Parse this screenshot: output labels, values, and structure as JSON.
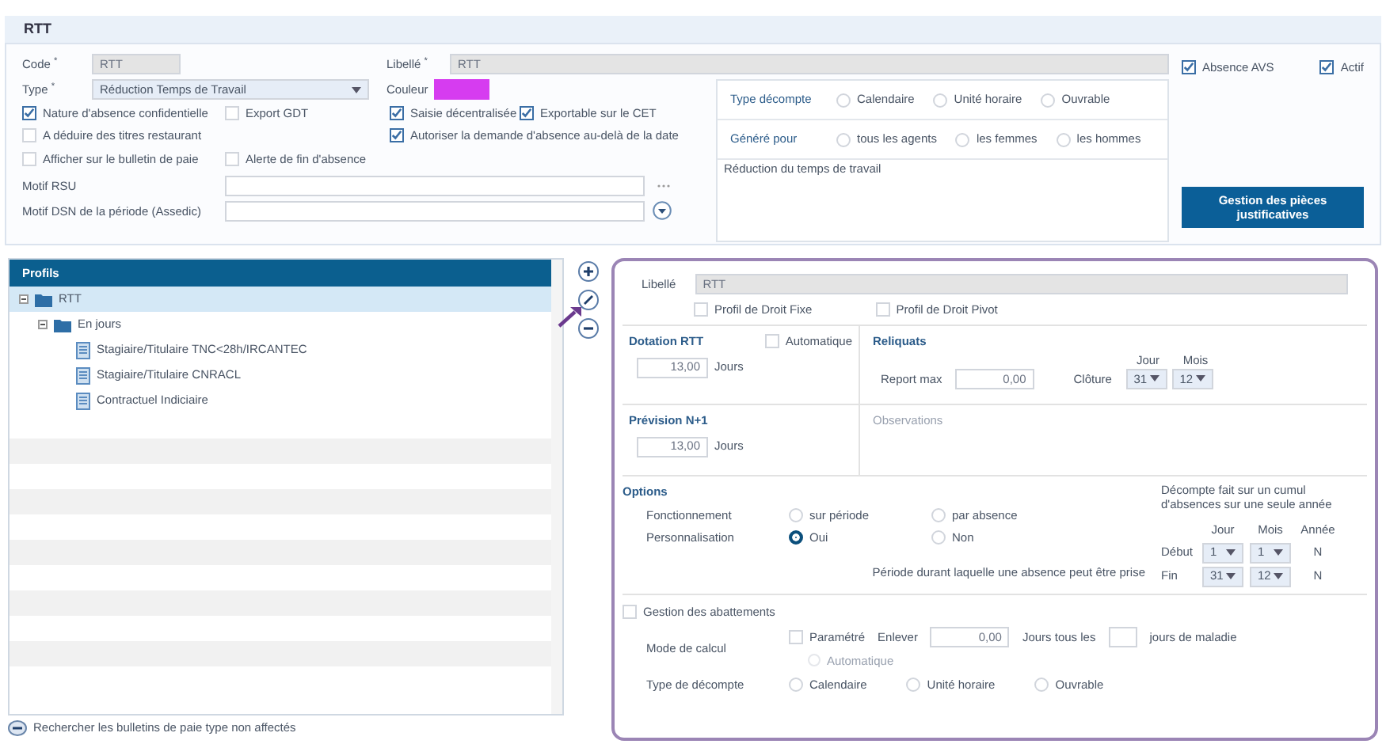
{
  "title": "RTT",
  "general": {
    "code": {
      "label": "Code $^{*}$",
      "value": "RTT"
    },
    "libelle": {
      "label": "Libellé $^{*}$",
      "value": "RTT"
    },
    "type": {
      "label": "Type $^{*}$",
      "value": "Réduction Temps de Travail"
    },
    "couleur": {
      "label": "Couleur",
      "color": "#d63cf0"
    },
    "flags": [
      {
        "label": "Nature d'absence confidentielle",
        "checked": true
      },
      {
        "label": "Export GDT",
        "checked": false
      },
      {
        "label": "Saisie décentralisée",
        "checked": true
      },
      {
        "label": "Exportable sur le CET",
        "checked": true
      },
      {
        "label": "A déduire des titres restaurant",
        "checked": false
      },
      {
        "label": "Autoriser la demande d'absence au-delà de la date",
        "checked": true
      },
      {
        "label": "Afficher sur le bulletin de paie",
        "checked": false
      },
      {
        "label": "Alerte de fin d'absence",
        "checked": false
      }
    ],
    "motif_rsu": {
      "label": "Motif RSU"
    },
    "motif_dsn": {
      "label": "Motif DSN de la période (Assedic)"
    },
    "type_decompte": {
      "label": "Type décompte",
      "options": [
        {
          "label": "Calendaire",
          "selected": false
        },
        {
          "label": "Unité horaire",
          "selected": false
        },
        {
          "label": "Ouvrable",
          "selected": false
        }
      ]
    },
    "genere_pour": {
      "label": "Généré pour",
      "options": [
        {
          "label": "tous les agents",
          "selected": false
        },
        {
          "label": "les femmes",
          "selected": false
        },
        {
          "label": "les hommes",
          "selected": false
        }
      ]
    },
    "description": "Réduction du temps de travail",
    "absence_avs": {
      "label": "Absence AVS",
      "checked": true
    },
    "actif": {
      "label": "Actif",
      "checked": true
    },
    "pieces_button": "Gestion des pièces justificatives"
  },
  "profiles": {
    "header": "Profils",
    "tree": [
      {
        "label": "RTT",
        "kind": "folder",
        "expanded": true,
        "selected": true,
        "children": [
          {
            "label": "En jours",
            "kind": "folder",
            "expanded": true,
            "selected": false,
            "children": [
              {
                "label": "Stagiaire/Titulaire TNC<28h/IRCANTEC",
                "kind": "document",
                "selected": false
              },
              {
                "label": "Stagiaire/Titulaire CNRACL",
                "kind": "document",
                "selected": false
              },
              {
                "label": "Contractuel Indiciaire",
                "kind": "document",
                "selected": false
              }
            ]
          }
        ]
      }
    ],
    "footer_link": "Rechercher les bulletins de paie type non affectés"
  },
  "detail": {
    "libelle": {
      "label": "Libellé",
      "value": "RTT"
    },
    "profile_flags": [
      {
        "label": "Profil de Droit Fixe",
        "checked": false
      },
      {
        "label": "Profil de Droit Pivot",
        "checked": false
      }
    ],
    "dotation": {
      "title": "Dotation RTT",
      "automatique": {
        "label": "Automatique",
        "checked": false
      },
      "value": "13,00",
      "unit": "Jours"
    },
    "reliquats": {
      "title": "Reliquats",
      "report_label": "Report max",
      "report_value": "0,00",
      "col_headers": [
        "Jour",
        "Mois"
      ],
      "cloture_label": "Clôture",
      "cloture_day": "31",
      "cloture_month": "12"
    },
    "prevision": {
      "title": "Prévision N+1",
      "value": "13,00",
      "unit": "Jours"
    },
    "observations_placeholder": "Observations",
    "options": {
      "title": "Options",
      "fonctionnement": {
        "label": "Fonctionnement",
        "options": [
          {
            "label": "sur période",
            "selected": false
          },
          {
            "label": "par absence",
            "selected": false
          }
        ]
      },
      "personnalisation": {
        "label": "Personnalisation",
        "options": [
          {
            "label": "Oui",
            "selected": true
          },
          {
            "label": "Non",
            "selected": false
          }
        ]
      },
      "note": "Décompte fait sur un cumul d'absences sur une seule année",
      "period_headers": [
        "Jour",
        "Mois",
        "Année"
      ],
      "period_label": "Période durant laquelle une absence peut être prise",
      "periods": [
        {
          "label": "Début",
          "day": "1",
          "month": "1",
          "year": "N"
        },
        {
          "label": "Fin",
          "day": "31",
          "month": "12",
          "year": "N"
        }
      ]
    },
    "abattements": {
      "toggle": {
        "label": "Gestion des abattements",
        "checked": false
      },
      "mode_label": "Mode de calcul",
      "parametre": {
        "label": "Paramétré",
        "checked": false
      },
      "enlever_label": "Enlever",
      "enlever_value": "0,00",
      "tous_les_label": "Jours tous les",
      "maladie_label": "jours de maladie",
      "automatique": {
        "label": "Automatique",
        "selected": false
      },
      "type_label": "Type de décompte",
      "type_options": [
        {
          "label": "Calendaire",
          "selected": false
        },
        {
          "label": "Unité horaire",
          "selected": false
        },
        {
          "label": "Ouvrable",
          "selected": false
        }
      ]
    }
  }
}
